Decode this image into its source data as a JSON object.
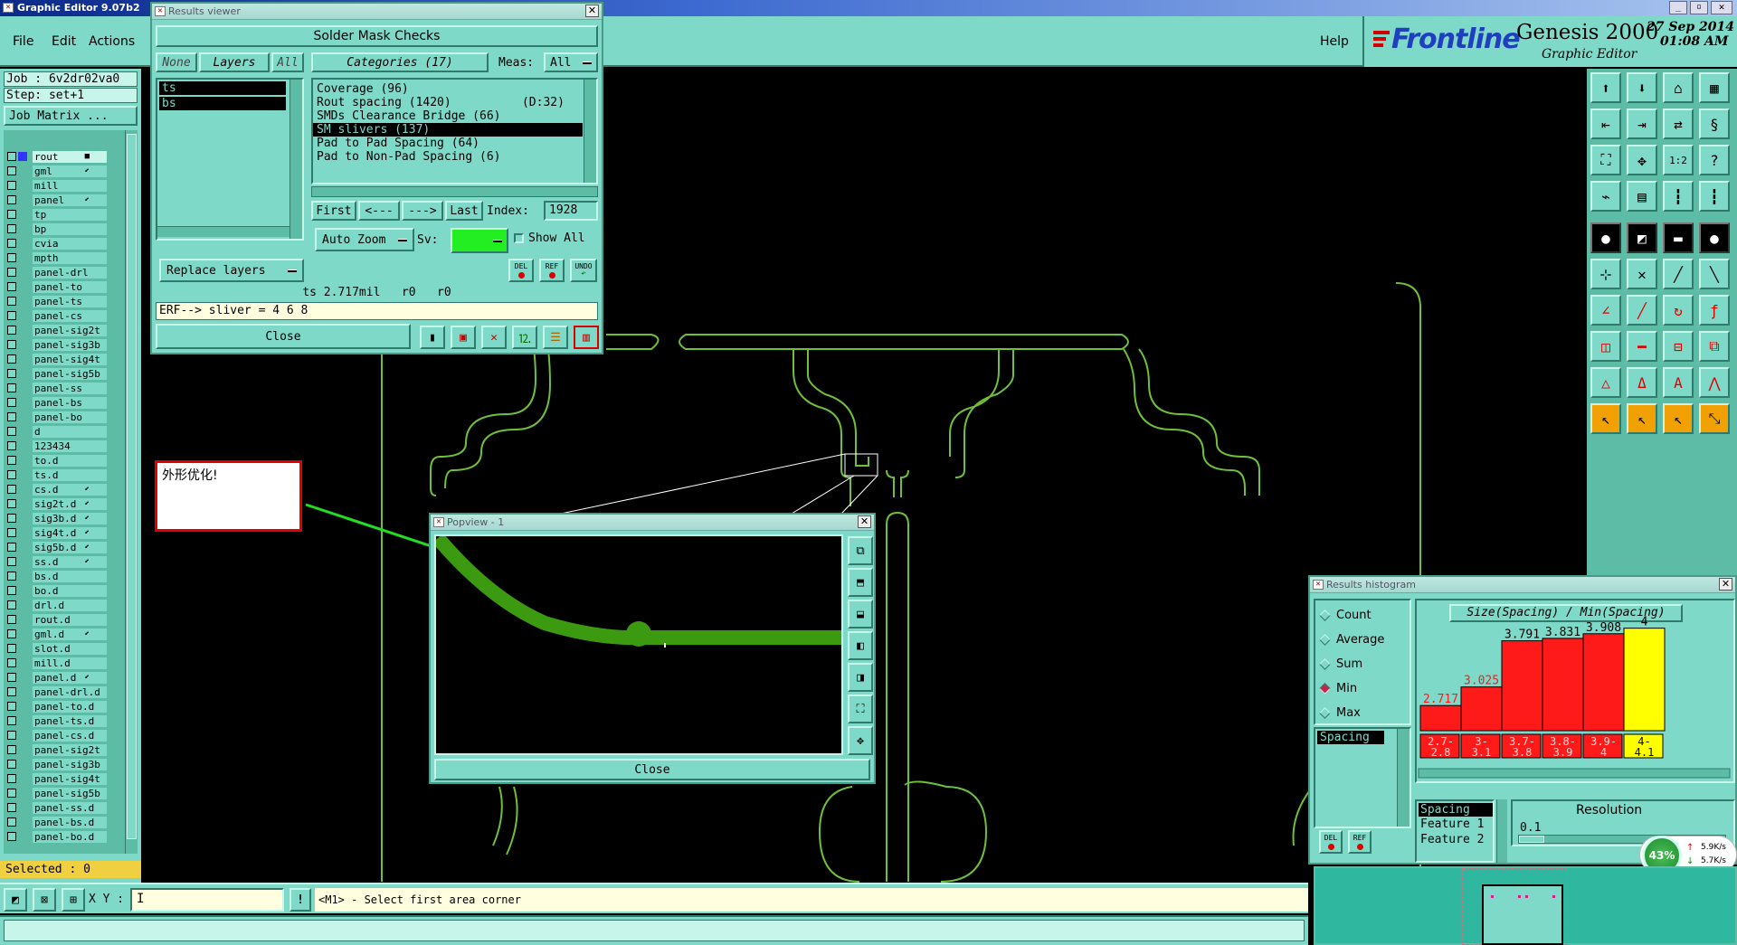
{
  "app": {
    "title": "Graphic Editor 9.07b2",
    "menu": [
      "File",
      "Edit",
      "Actions"
    ],
    "help": "Help",
    "brand": "Frontline",
    "product": "Genesis 2000",
    "subtitle": "Graphic Editor",
    "date": "27 Sep 2014",
    "time": "01:08 AM"
  },
  "job": {
    "job_label": "Job : 6v2dr02va0",
    "step_label": "Step: set+1",
    "matrix_button": "Job Matrix ..."
  },
  "layers": [
    {
      "name": "rout",
      "tag": "■",
      "color": "#3333ff"
    },
    {
      "name": "gml",
      "tag": "⬋"
    },
    {
      "name": "mill",
      "tag": ""
    },
    {
      "name": "panel",
      "tag": "⬋"
    },
    {
      "name": "tp",
      "tag": ""
    },
    {
      "name": "bp",
      "tag": ""
    },
    {
      "name": "cvia",
      "tag": ""
    },
    {
      "name": "mpth",
      "tag": ""
    },
    {
      "name": "panel-drl",
      "tag": ""
    },
    {
      "name": "panel-to",
      "tag": ""
    },
    {
      "name": "panel-ts",
      "tag": ""
    },
    {
      "name": "panel-cs",
      "tag": ""
    },
    {
      "name": "panel-sig2t",
      "tag": ""
    },
    {
      "name": "panel-sig3b",
      "tag": ""
    },
    {
      "name": "panel-sig4t",
      "tag": ""
    },
    {
      "name": "panel-sig5b",
      "tag": ""
    },
    {
      "name": "panel-ss",
      "tag": ""
    },
    {
      "name": "panel-bs",
      "tag": ""
    },
    {
      "name": "panel-bo",
      "tag": ""
    },
    {
      "name": "d",
      "tag": ""
    },
    {
      "name": "123434",
      "tag": ""
    },
    {
      "name": "to.d",
      "tag": ""
    },
    {
      "name": "ts.d",
      "tag": ""
    },
    {
      "name": "cs.d",
      "tag": "⬋"
    },
    {
      "name": "sig2t.d",
      "tag": "⬋"
    },
    {
      "name": "sig3b.d",
      "tag": "⬋"
    },
    {
      "name": "sig4t.d",
      "tag": "⬋"
    },
    {
      "name": "sig5b.d",
      "tag": "⬋"
    },
    {
      "name": "ss.d",
      "tag": "⬋"
    },
    {
      "name": "bs.d",
      "tag": ""
    },
    {
      "name": "bo.d",
      "tag": ""
    },
    {
      "name": "drl.d",
      "tag": ""
    },
    {
      "name": "rout.d",
      "tag": ""
    },
    {
      "name": "gml.d",
      "tag": "⬋"
    },
    {
      "name": "slot.d",
      "tag": ""
    },
    {
      "name": "mill.d",
      "tag": ""
    },
    {
      "name": "panel.d",
      "tag": "⬋"
    },
    {
      "name": "panel-drl.d",
      "tag": ""
    },
    {
      "name": "panel-to.d",
      "tag": ""
    },
    {
      "name": "panel-ts.d",
      "tag": ""
    },
    {
      "name": "panel-cs.d",
      "tag": ""
    },
    {
      "name": "panel-sig2t",
      "tag": ""
    },
    {
      "name": "panel-sig3b",
      "tag": ""
    },
    {
      "name": "panel-sig4t",
      "tag": ""
    },
    {
      "name": "panel-sig5b",
      "tag": ""
    },
    {
      "name": "panel-ss.d",
      "tag": ""
    },
    {
      "name": "panel-bs.d",
      "tag": ""
    },
    {
      "name": "panel-bo.d",
      "tag": ""
    }
  ],
  "selected": "Selected : 0",
  "results_viewer": {
    "title": "Results viewer",
    "header": "Solder Mask Checks",
    "none": "None",
    "layers": "Layers",
    "all": "All",
    "categories_label": "Categories (17)",
    "meas_label": "Meas:",
    "meas_value": "All",
    "layer_items": [
      "ts",
      "bs"
    ],
    "categories": [
      "Coverage (96)",
      "Rout spacing (1420)          (D:32)",
      "SMDs Clearance Bridge (66)",
      "SM slivers (137)",
      "Pad to Pad Spacing (64)",
      "Pad to Non-Pad Spacing (6)"
    ],
    "selected_category": 3,
    "first": "First",
    "prev": "<---",
    "next": "--->",
    "last": "Last",
    "index_label": "Index:",
    "index_value": "1928",
    "replace_layers": "Replace layers",
    "auto_zoom": "Auto Zoom",
    "sv_label": "Sv:",
    "show_all": "Show All",
    "icon_labels": [
      "DEL",
      "REF",
      "UNDO"
    ],
    "info_line": "ts 2.717mil   r0   r0",
    "erf_line": "ERF--> sliver = 4 6 8",
    "close": "Close"
  },
  "annotation": {
    "text": "外形优化!"
  },
  "popview": {
    "title": "Popview - 1",
    "close": "Close"
  },
  "histogram": {
    "title": "Results histogram",
    "options": [
      "Count",
      "Average",
      "Sum",
      "Min",
      "Max"
    ],
    "selected_option": "Min",
    "list_item": "Spacing",
    "chart_title": "Size(Spacing) / Min(Spacing)",
    "fields": [
      "Spacing",
      "Feature 1",
      "Feature 2"
    ],
    "resolution_label": "Resolution",
    "resolution_value": "0.1",
    "icon_labels": [
      "DEL",
      "REF"
    ]
  },
  "chart_data": {
    "type": "bar",
    "title": "Size(Spacing) / Min(Spacing)",
    "categories": [
      "2.7-2.8",
      "3-3.1",
      "3.7-3.8",
      "3.8-3.9",
      "3.9-4",
      "4-4.1"
    ],
    "values": [
      2.717,
      3.025,
      3.791,
      3.831,
      3.908,
      4
    ],
    "value_labels": [
      "2.717",
      "3.025",
      "3.791",
      "3.831",
      "3.908",
      "4"
    ],
    "category_lines": [
      [
        "2.7-",
        "2.8"
      ],
      [
        "3-",
        "3.1"
      ],
      [
        "3.7-",
        "3.8"
      ],
      [
        "3.8-",
        "3.9"
      ],
      [
        "3.9-",
        "4"
      ],
      [
        "4-",
        "4.1"
      ]
    ],
    "colors": [
      "#ff1a1a",
      "#ff1a1a",
      "#ff1a1a",
      "#ff1a1a",
      "#ff1a1a",
      "#ffff00"
    ],
    "ylim": [
      0,
      4.1
    ],
    "grid": false
  },
  "status": {
    "xy_label": "X Y :",
    "message": "<M1> - Select first area corner"
  },
  "net": {
    "percent": "43%",
    "up": "5.9K/s",
    "down": "5.7K/s"
  },
  "colors": {
    "panel_teal": "#7fd9c8",
    "outline_green": "#6fbf3a",
    "brand_blue": "#1f3fbf",
    "brand_red": "#d40000"
  }
}
